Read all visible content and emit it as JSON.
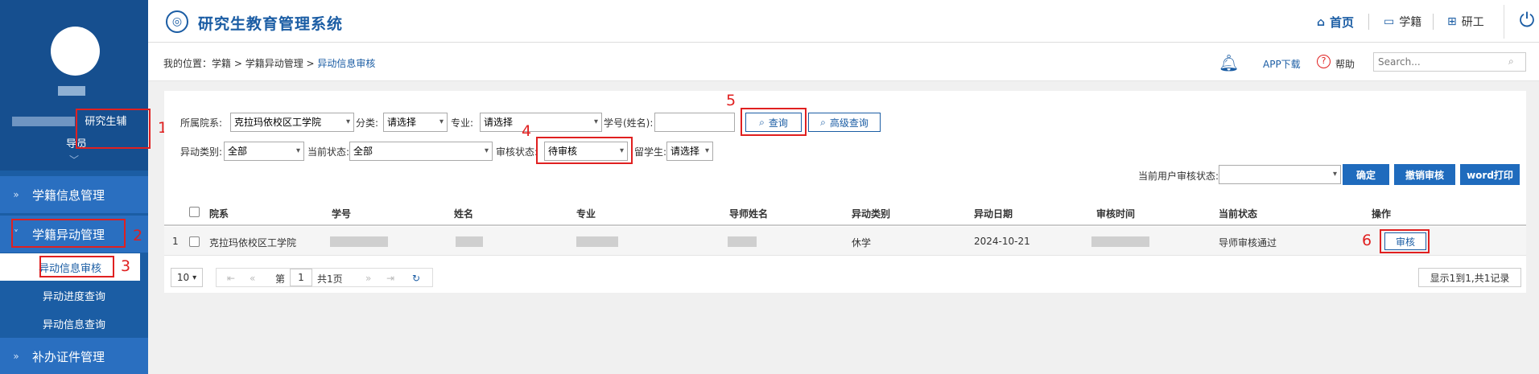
{
  "app": {
    "title": "研究生教育管理系统",
    "logo_icon": "university-seal-icon"
  },
  "header_nav": [
    {
      "label": "首页",
      "icon": "home-icon"
    },
    {
      "label": "学籍",
      "icon": "id-card-icon"
    },
    {
      "label": "研工",
      "icon": "grid-icon"
    }
  ],
  "sidebar": {
    "role": "研究生辅",
    "role_line2": "导员",
    "menu": [
      {
        "label": "学籍信息管理"
      },
      {
        "label": "学籍异动管理"
      },
      {
        "label": "补办证件管理"
      }
    ],
    "submenu": [
      {
        "label": "异动信息审核"
      },
      {
        "label": "异动进度查询"
      },
      {
        "label": "异动信息查询"
      }
    ]
  },
  "breadcrumb": {
    "prefix": "我的位置：",
    "path": "学籍 > 学籍异动管理 > ",
    "current": "异动信息审核"
  },
  "toolbar": {
    "app_download": "APP下载",
    "help": "帮助",
    "search_placeholder": "Search..."
  },
  "filters": {
    "college_label": "所属院系:",
    "college_value": "克拉玛依校区工学院",
    "category_label": "分类:",
    "category_value": "请选择",
    "major_label": "专业:",
    "major_value": "请选择",
    "student_label": "学号(姓名):",
    "change_type_label": "异动类别:",
    "change_type_value": "全部",
    "current_status_label": "当前状态:",
    "current_status_value": "全部",
    "review_status_label": "审核状态:",
    "review_status_value": "待审核",
    "intl_label": "留学生:",
    "intl_value": "请选择",
    "user_review_label": "当前用户审核状态:",
    "user_review_value": ""
  },
  "buttons": {
    "query": "查询",
    "advanced_query": "高级查询",
    "confirm": "确定",
    "cancel_review": "撤销审核",
    "word_print": "word打印"
  },
  "table": {
    "columns": [
      "院系",
      "学号",
      "姓名",
      "专业",
      "导师姓名",
      "异动类别",
      "异动日期",
      "审核时间",
      "当前状态",
      "操作"
    ],
    "rows": [
      {
        "index": "1",
        "college": "克拉玛依校区工学院",
        "change_type": "休学",
        "change_date": "2024-10-21",
        "status": "导师审核通过",
        "action": "审核"
      }
    ]
  },
  "pager": {
    "page_size": "10",
    "page_prefix": "第",
    "page_number": "1",
    "page_total": "共1页",
    "summary": "显示1到1,共1记录"
  },
  "annotations": [
    "1",
    "2",
    "3",
    "4",
    "5",
    "6"
  ],
  "colors": {
    "primary": "#1b5da4",
    "sidebar": "#1b5da4",
    "highlight": "#e02020",
    "button": "#1f6bbd"
  }
}
